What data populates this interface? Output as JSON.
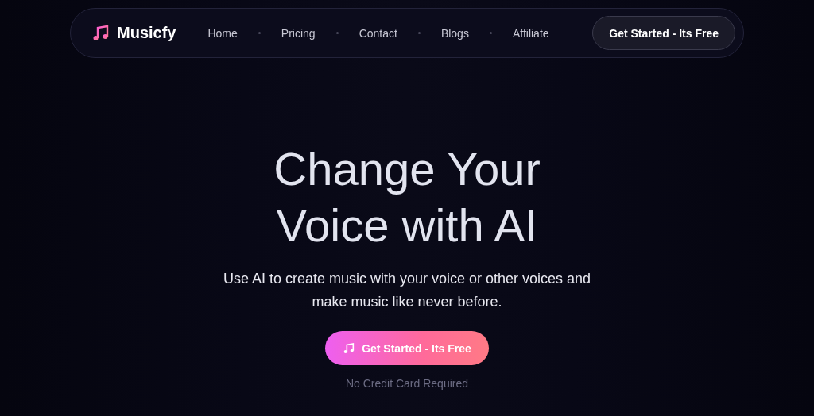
{
  "brand": {
    "name": "Musicfy"
  },
  "nav": {
    "links": [
      "Home",
      "Pricing",
      "Contact",
      "Blogs",
      "Affiliate"
    ],
    "cta": "Get Started - Its Free"
  },
  "hero": {
    "title_lines": [
      "Change Your",
      "Voice with AI"
    ],
    "subtitle": "Use AI to create music with your voice or other voices and make music like never before.",
    "cta": "Get Started - Its Free",
    "note": "No Credit Card Required"
  }
}
